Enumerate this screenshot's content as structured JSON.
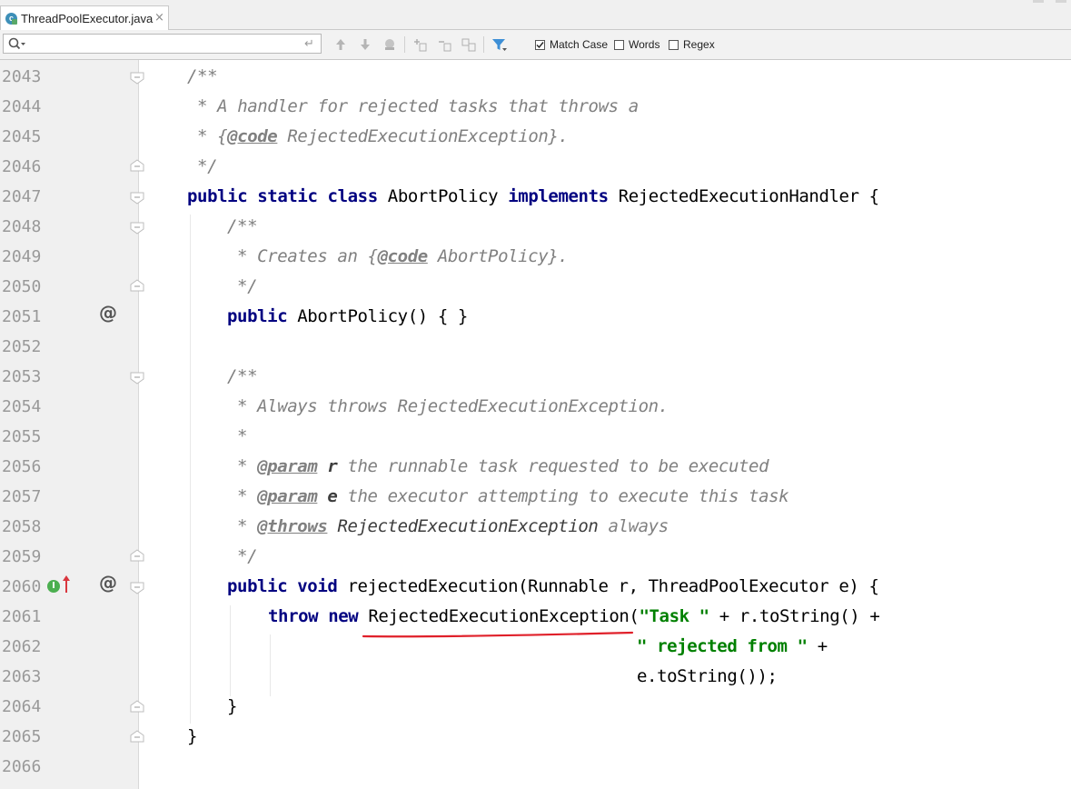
{
  "tab": {
    "icon_letter": "c",
    "title": "ThreadPoolExecutor.java",
    "close": "×"
  },
  "search": {
    "value": "",
    "placeholder": "",
    "icon": "search-icon",
    "enter_glyph": "↵",
    "options": [
      {
        "label": "Match Case",
        "checked": true
      },
      {
        "label": "Words",
        "checked": false
      },
      {
        "label": "Regex",
        "checked": false
      }
    ]
  },
  "lines": [
    {
      "no": "2043",
      "html_key": "l2043"
    },
    {
      "no": "2044"
    },
    {
      "no": "2045"
    },
    {
      "no": "2046"
    },
    {
      "no": "2047"
    },
    {
      "no": "2048"
    },
    {
      "no": "2049"
    },
    {
      "no": "2050"
    },
    {
      "no": "2051"
    },
    {
      "no": "2052"
    },
    {
      "no": "2053"
    },
    {
      "no": "2054"
    },
    {
      "no": "2055"
    },
    {
      "no": "2056"
    },
    {
      "no": "2057"
    },
    {
      "no": "2058"
    },
    {
      "no": "2059"
    },
    {
      "no": "2060"
    },
    {
      "no": "2061"
    },
    {
      "no": "2062"
    },
    {
      "no": "2063"
    },
    {
      "no": "2064"
    },
    {
      "no": "2065"
    },
    {
      "no": "2066"
    }
  ],
  "code": {
    "c2043": "/**",
    "c2044": " * A handler for rejected tasks that throws a",
    "c2045_a": " * {",
    "c2045_tag": "@code",
    "c2045_b": " RejectedExecutionException}.",
    "c2046": " */",
    "c2047_kw": "public static class",
    "c2047_a": " AbortPolicy ",
    "c2047_kw2": "implements",
    "c2047_b": " RejectedExecutionHandler {",
    "c2048": "/**",
    "c2049_a": " * Creates an {",
    "c2049_tag": "@code",
    "c2049_b": " AbortPolicy}.",
    "c2050": " */",
    "c2051_kw": "public",
    "c2051_a": " AbortPolicy() { }",
    "c2053": "/**",
    "c2054": " * Always throws RejectedExecutionException.",
    "c2055": " *",
    "c2056_a": " * ",
    "c2056_tag": "@param",
    "c2056_p": " r",
    "c2056_b": " the runnable task requested to be executed",
    "c2057_a": " * ",
    "c2057_tag": "@param",
    "c2057_p": " e",
    "c2057_b": " the executor attempting to execute this task",
    "c2058_a": " * ",
    "c2058_tag": "@throws",
    "c2058_p": " RejectedExecutionException",
    "c2058_b": " always",
    "c2059": " */",
    "c2060_kw": "public void",
    "c2060_a": " rejectedExecution(Runnable r, ThreadPoolExecutor e) {",
    "c2061_kw": "throw new",
    "c2061_a": " RejectedExecutionException(",
    "c2061_str": "\"Task \"",
    "c2061_b": " + r.toString() +",
    "c2062_str": "\" rejected from \"",
    "c2062_b": " +",
    "c2063": "e.toString());",
    "c2064": "}",
    "c2065": "}"
  },
  "gutter": {
    "annotation_glyph": "@",
    "implements_letter": "I"
  },
  "colors": {
    "keyword": "#000080",
    "comment": "#808080",
    "string": "#008000",
    "line_number": "#999999",
    "underline": "#e0202a"
  }
}
